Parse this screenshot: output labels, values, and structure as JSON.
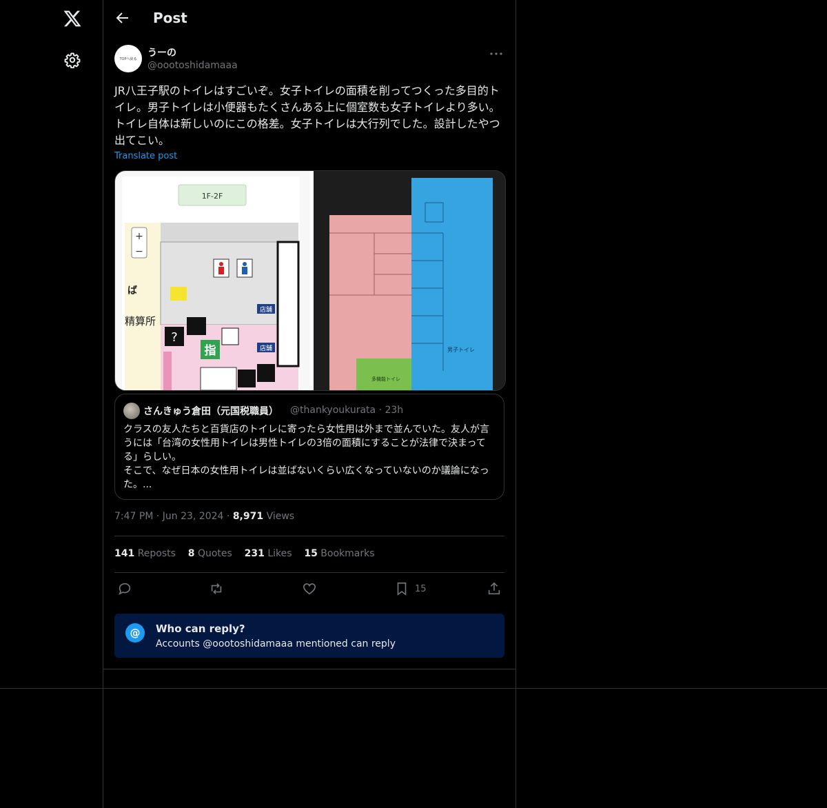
{
  "nav": {
    "logo": "x-logo-icon",
    "settings": "gear-icon"
  },
  "header": {
    "title": "Post"
  },
  "post": {
    "avatar_text": "TOPへ戻る",
    "display_name": "うーの",
    "handle": "@oootoshidamaaa",
    "text": "JR八王子駅のトイレはすごいぞ。女子トイレの面積を削ってつくった多目的トイレ。男子トイレは小便器もたくさんある上に個室数も女子トイレより多い。トイレ自体は新しいのにこの格差。女子トイレは大行列でした。設計したやつ出てこい。",
    "translate": "Translate post",
    "media": {
      "left": {
        "floor": "1F-2F",
        "label_ba": "ば",
        "label_seisan": "精算所",
        "label_shi": "指",
        "tenpo": "店舗"
      },
      "right": {
        "mens": "男子トイレ",
        "multi": "多機能トイレ"
      }
    },
    "quote": {
      "name": "さんきゅう倉田（元国税職員）",
      "handle": "@thankyoukurata",
      "time": "· 23h",
      "text": "クラスの友人たちと百貨店のトイレに寄ったら女性用は外まで並んでいた。友人が言うには「台湾の女性用トイレは男性トイレの3倍の面積にすることが法律で決まってる」らしい。\nそこで、なぜ日本の女性用トイレは並ばないくらい広くなっていないのか議論になった。..."
    },
    "time": "7:47 PM",
    "date": "Jun 23, 2024",
    "views_count": "8,971",
    "views_label": "Views",
    "stats": {
      "reposts": "141",
      "reposts_label": "Reposts",
      "quotes": "8",
      "quotes_label": "Quotes",
      "likes": "231",
      "likes_label": "Likes",
      "bookmarks": "15",
      "bookmarks_label": "Bookmarks"
    },
    "bookmark_count": "15",
    "who_can_reply": {
      "title": "Who can reply?",
      "subtitle": "Accounts @oootoshidamaaa mentioned can reply"
    }
  },
  "colors": {
    "accent": "#1d9bf0",
    "background": "#000000",
    "border": "#2f3336",
    "muted": "#71767b"
  }
}
